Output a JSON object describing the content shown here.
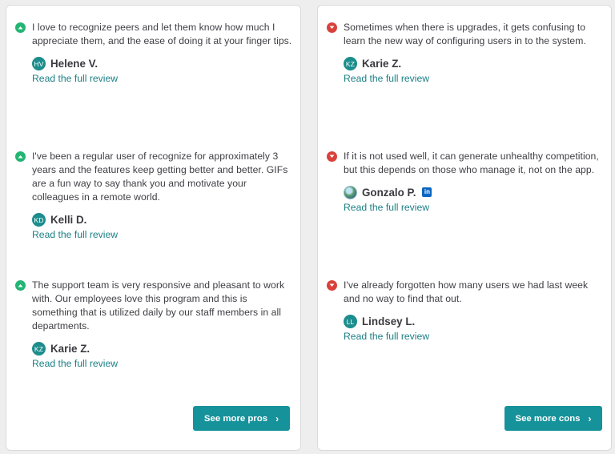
{
  "pros": {
    "reviews": [
      {
        "text": "I love to recognize peers and let them know how much I appreciate them, and the ease of doing it at your finger tips.",
        "initials": "HV",
        "name": "Helene V.",
        "link": "Read the full review"
      },
      {
        "text": "I've been a regular user of recognize for approximately 3 years and the features keep getting better and better. GIFs are a fun way to say thank you and motivate your colleagues in a remote world.",
        "initials": "KD",
        "name": "Kelli D.",
        "link": "Read the full review"
      },
      {
        "text": "The support team is very responsive and pleasant to work with. Our employees love this program and this is something that is utilized daily by our staff members in all departments.",
        "initials": "KZ",
        "name": "Karie Z.",
        "link": "Read the full review"
      }
    ],
    "button_label": "See more pros",
    "button_chevron": "›"
  },
  "cons": {
    "reviews": [
      {
        "text": "Sometimes when there is upgrades, it gets confusing to learn the new way of configuring users in to the system.",
        "initials": "KZ",
        "name": "Karie Z.",
        "link": "Read the full review"
      },
      {
        "text": "If it is not used well, it can generate unhealthy competition, but this depends on those who manage it, not on the app.",
        "initials": "",
        "name": "Gonzalo P.",
        "linkedin": "in",
        "link": "Read the full review"
      },
      {
        "text": "I've already forgotten how many users we had last week and no way to find that out.",
        "initials": "LL",
        "name": "Lindsey L.",
        "link": "Read the full review"
      }
    ],
    "button_label": "See more cons",
    "button_chevron": "›"
  },
  "colors": {
    "pro_indicator": "#22b573",
    "con_indicator": "#d9413b",
    "accent": "#16929a",
    "link": "#1b7f84"
  }
}
